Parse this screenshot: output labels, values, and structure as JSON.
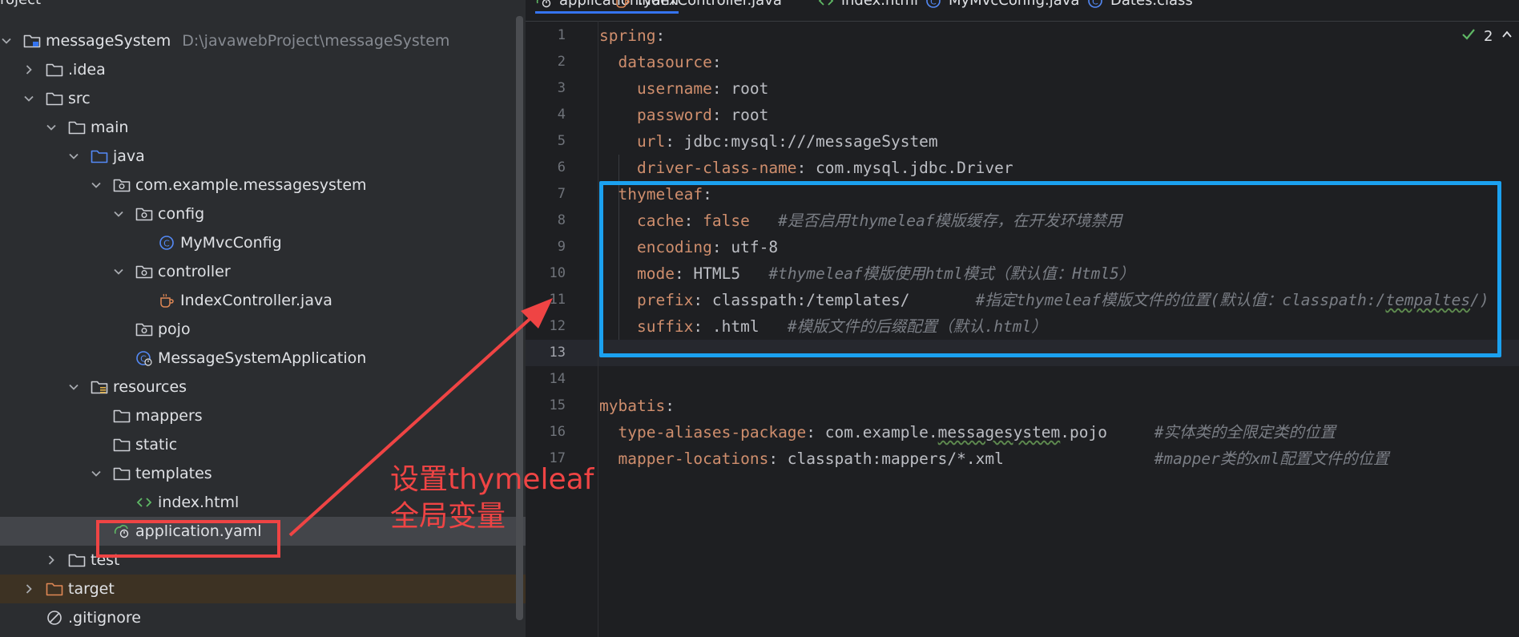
{
  "project_panel": {
    "title": "roject",
    "tree": [
      {
        "label": "messageSystem",
        "path": "D:\\javawebProject\\messageSystem",
        "icon": "module-folder-icon",
        "arrow": "expanded"
      },
      {
        "label": ".idea",
        "icon": "folder-icon",
        "arrow": "collapsed"
      },
      {
        "label": "src",
        "icon": "folder-icon",
        "arrow": "expanded"
      },
      {
        "label": "main",
        "icon": "folder-icon",
        "arrow": "expanded"
      },
      {
        "label": "java",
        "icon": "source-folder-icon",
        "arrow": "expanded"
      },
      {
        "label": "com.example.messagesystem",
        "icon": "package-icon",
        "arrow": "expanded"
      },
      {
        "label": "config",
        "icon": "package-icon",
        "arrow": "expanded"
      },
      {
        "label": "MyMvcConfig",
        "icon": "java-class-icon",
        "arrow": "none"
      },
      {
        "label": "controller",
        "icon": "package-icon",
        "arrow": "expanded"
      },
      {
        "label": "IndexController.java",
        "icon": "java-file-icon",
        "arrow": "none"
      },
      {
        "label": "pojo",
        "icon": "package-icon",
        "arrow": "none"
      },
      {
        "label": "MessageSystemApplication",
        "icon": "spring-boot-app-icon",
        "arrow": "none"
      },
      {
        "label": "resources",
        "icon": "resources-folder-icon",
        "arrow": "expanded"
      },
      {
        "label": "mappers",
        "icon": "folder-icon",
        "arrow": "none"
      },
      {
        "label": "static",
        "icon": "folder-icon",
        "arrow": "none"
      },
      {
        "label": "templates",
        "icon": "folder-icon",
        "arrow": "expanded"
      },
      {
        "label": "index.html",
        "icon": "html-file-icon",
        "arrow": "none"
      },
      {
        "label": "application.yaml",
        "icon": "yaml-config-icon",
        "arrow": "none"
      },
      {
        "label": "test",
        "icon": "folder-icon",
        "arrow": "collapsed"
      },
      {
        "label": "target",
        "icon": "excluded-folder-icon",
        "arrow": "collapsed"
      },
      {
        "label": ".gitignore",
        "icon": "ignore-file-icon",
        "arrow": "none"
      }
    ]
  },
  "editor": {
    "tabs": [
      {
        "label": "application.yaml",
        "icon": "yaml-config-icon",
        "active": true
      },
      {
        "label": "IndexController.java",
        "icon": "java-file-icon",
        "active": false
      },
      {
        "label": "index.html",
        "icon": "html-file-icon",
        "active": false
      },
      {
        "label": "MyMvcConfig.java",
        "icon": "java-class-icon",
        "active": false
      },
      {
        "label": "Dates.class",
        "icon": "class-file-icon",
        "active": false
      }
    ],
    "inspection": {
      "icon": "check-icon",
      "count": "2",
      "chevron": "chevron-up-icon"
    },
    "current_line": 13,
    "lines": [
      {
        "n": "1",
        "tokens": [
          [
            "k",
            "spring"
          ],
          [
            "v",
            ":"
          ]
        ]
      },
      {
        "n": "2",
        "tokens": [
          [
            "v",
            "  "
          ],
          [
            "k",
            "datasource"
          ],
          [
            "v",
            ":"
          ]
        ]
      },
      {
        "n": "3",
        "tokens": [
          [
            "v",
            "    "
          ],
          [
            "k",
            "username"
          ],
          [
            "v",
            ": root"
          ]
        ]
      },
      {
        "n": "4",
        "tokens": [
          [
            "v",
            "    "
          ],
          [
            "k",
            "password"
          ],
          [
            "v",
            ": root"
          ]
        ]
      },
      {
        "n": "5",
        "tokens": [
          [
            "v",
            "    "
          ],
          [
            "k",
            "url"
          ],
          [
            "v",
            ": jdbc:mysql:///messageSystem"
          ]
        ]
      },
      {
        "n": "6",
        "tokens": [
          [
            "v",
            "    "
          ],
          [
            "k",
            "driver-class-name"
          ],
          [
            "v",
            ": com.mysql.jdbc.Driver"
          ]
        ]
      },
      {
        "n": "7",
        "tokens": [
          [
            "v",
            "  "
          ],
          [
            "k",
            "thymeleaf"
          ],
          [
            "v",
            ":"
          ]
        ]
      },
      {
        "n": "8",
        "tokens": [
          [
            "v",
            "    "
          ],
          [
            "k",
            "cache"
          ],
          [
            "v",
            ": "
          ],
          [
            "b",
            "false"
          ],
          [
            "v",
            "   "
          ],
          [
            "c",
            "#是否启用thymeleaf模版缓存，在开发环境禁用"
          ]
        ]
      },
      {
        "n": "9",
        "tokens": [
          [
            "v",
            "    "
          ],
          [
            "k",
            "encoding"
          ],
          [
            "v",
            ": utf-8"
          ]
        ]
      },
      {
        "n": "10",
        "tokens": [
          [
            "v",
            "    "
          ],
          [
            "k",
            "mode"
          ],
          [
            "v",
            ": HTML5   "
          ],
          [
            "c",
            "#thymeleaf模版使用html模式（默认值：Html5）"
          ]
        ]
      },
      {
        "n": "11",
        "tokens": [
          [
            "v",
            "    "
          ],
          [
            "k",
            "prefix"
          ],
          [
            "v",
            ": classpath:/templates/       "
          ],
          [
            "c",
            "#指定thymeleaf模版文件的位置(默认值：classpath:/"
          ],
          [
            "cu",
            "tempaltes"
          ],
          [
            "c",
            "/)"
          ]
        ]
      },
      {
        "n": "12",
        "tokens": [
          [
            "v",
            "    "
          ],
          [
            "k",
            "suffix"
          ],
          [
            "v",
            ": .html   "
          ],
          [
            "c",
            "#模版文件的后缀配置（默认.html）"
          ]
        ]
      },
      {
        "n": "13",
        "tokens": []
      },
      {
        "n": "14",
        "tokens": []
      },
      {
        "n": "15",
        "tokens": [
          [
            "k",
            "mybatis"
          ],
          [
            "v",
            ":"
          ]
        ]
      },
      {
        "n": "16",
        "tokens": [
          [
            "v",
            "  "
          ],
          [
            "k",
            "type-aliases-package"
          ],
          [
            "v",
            ": com.example."
          ],
          [
            "vu",
            "messagesystem"
          ],
          [
            "v",
            ".pojo     "
          ],
          [
            "c",
            "#实体类的全限定类的位置"
          ]
        ]
      },
      {
        "n": "17",
        "tokens": [
          [
            "v",
            "  "
          ],
          [
            "k",
            "mapper-locations"
          ],
          [
            "v",
            ": classpath:mappers/*.xml                "
          ],
          [
            "c",
            "#mapper类的xml配置文件的位置"
          ]
        ]
      }
    ]
  },
  "annotation": {
    "text_line1": "设置thymeleaf",
    "text_line2": "全局变量",
    "color_red": "#ef4444",
    "color_blue": "#1ba1f0"
  }
}
